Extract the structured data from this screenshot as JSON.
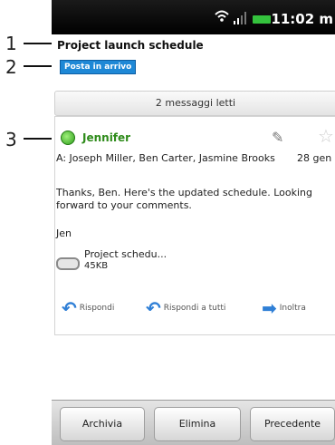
{
  "status_bar": {
    "time": "11:02 m"
  },
  "email": {
    "subject": "Project launch schedule",
    "label": "Posta in arrivo",
    "read_count": "2 messaggi letti",
    "sender": "Jennifer",
    "to_line": "A: Joseph Miller, Ben Carter, Jasmine Brooks",
    "date": "28 gen",
    "body": "Thanks, Ben. Here's the updated schedule. Looking forward to your comments.",
    "signature": "Jen",
    "attachment": {
      "name": "Project schedu...",
      "size": "45KB"
    }
  },
  "actions": {
    "reply": "Rispondi",
    "reply_all": "Rispondi a tutti",
    "forward": "Inoltra"
  },
  "bottom": {
    "archive": "Archivia",
    "delete": "Elimina",
    "previous": "Precedente"
  },
  "callouts": [
    "1",
    "2",
    "3"
  ],
  "colors": {
    "accent": "#1e88d6",
    "sender": "#2e8b1a",
    "battery": "#34c23d"
  },
  "icons": {
    "attachment": "paperclip-icon",
    "star": "star-icon",
    "reply": "reply-icon",
    "reply_all": "reply-all-icon",
    "forward": "forward-icon"
  }
}
